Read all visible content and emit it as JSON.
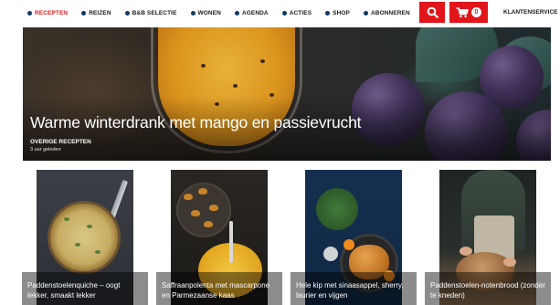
{
  "nav": {
    "items": [
      {
        "label": "RECEPTEN",
        "active": true
      },
      {
        "label": "REIZEN",
        "active": false
      },
      {
        "label": "B&B SELECTIE",
        "active": false
      },
      {
        "label": "WONEN",
        "active": false
      },
      {
        "label": "AGENDA",
        "active": false
      },
      {
        "label": "ACTIES",
        "active": false
      },
      {
        "label": "SHOP",
        "active": false
      },
      {
        "label": "ABONNEREN",
        "active": false
      }
    ],
    "search_icon": "search-icon",
    "cart_icon": "cart-icon",
    "cart_count": "0",
    "account_label": "KLANTENSERVICE"
  },
  "hero": {
    "title": "Warme winterdrank met mango en passievrucht",
    "category": "OVERIGE RECEPTEN",
    "time": "3 uur geleden"
  },
  "cards": [
    {
      "title": "Paddenstoelenquiche – oogt lekker, smaakt lekker"
    },
    {
      "title": "Saffraanpolenta met mascarpone en Parmezaanse kaas"
    },
    {
      "title": "Hele kip met sinaasappel, sherry, laurier en vijgen"
    },
    {
      "title": "Paddenstoelen-notenbrood (zonder te kneden)"
    }
  ],
  "colors": {
    "accent_red": "#e0161b",
    "active_nav": "#d81e1e",
    "nav_dot": "#0c3a68"
  }
}
